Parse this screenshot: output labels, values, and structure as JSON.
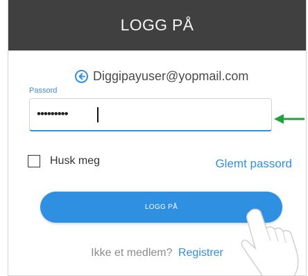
{
  "header": {
    "title": "LOGG PÅ"
  },
  "account": {
    "email": "Diggipayuser@yopmail.com",
    "back_icon": "arrow-left-circle-icon"
  },
  "password": {
    "label": "Passord",
    "value": "•••••••••"
  },
  "remember": {
    "label": "Husk meg",
    "checked": false
  },
  "links": {
    "forgot": "Glemt passord",
    "signup_prompt": "Ikke et medlem?",
    "signup_link": "Registrer"
  },
  "login_button": {
    "label": "LOGG PÅ"
  },
  "colors": {
    "header_bg": "#404040",
    "accent": "#2f8fe0",
    "annotation_arrow": "#21a13a"
  }
}
